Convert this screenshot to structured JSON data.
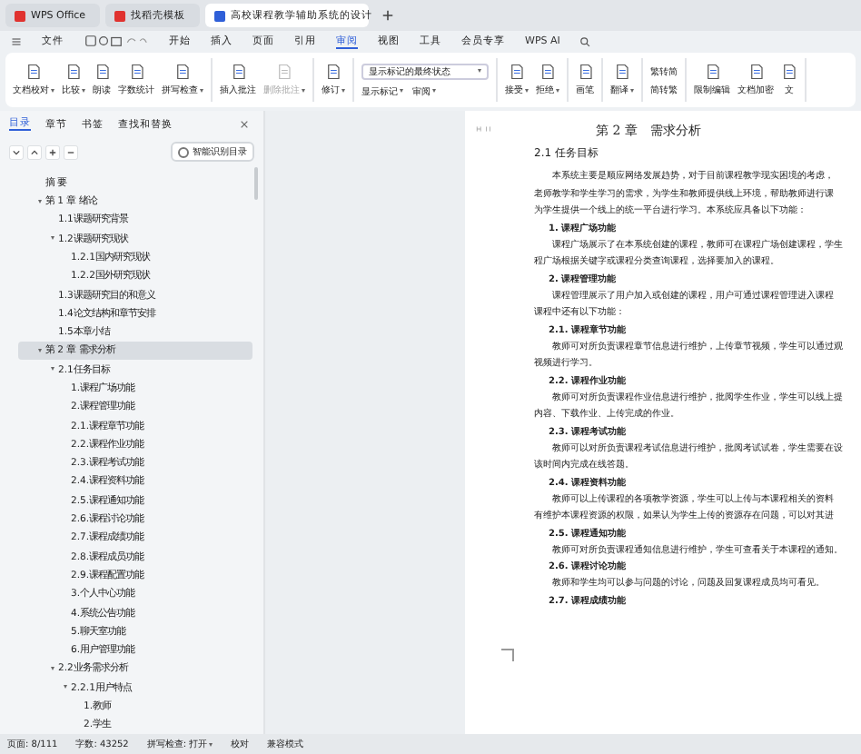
{
  "browser_tabs": [
    {
      "label": "WPS Office",
      "selected": false,
      "color": "#e0322f"
    },
    {
      "label": "找稻壳模板",
      "selected": false,
      "color": "#e0322f"
    },
    {
      "label": "高校课程教学辅助系统的设计",
      "selected": true,
      "color": "#2f5fd8"
    }
  ],
  "menu": {
    "file_label": "文件",
    "items": [
      {
        "label": "开始",
        "selected": false
      },
      {
        "label": "插入",
        "selected": false
      },
      {
        "label": "页面",
        "selected": false
      },
      {
        "label": "引用",
        "selected": false
      },
      {
        "label": "审阅",
        "selected": true
      },
      {
        "label": "视图",
        "selected": false
      },
      {
        "label": "工具",
        "selected": false
      },
      {
        "label": "会员专享",
        "selected": false
      }
    ],
    "ai_label": "WPS AI"
  },
  "ribbon": [
    [
      {
        "label": "文档校对",
        "dropdown": true
      },
      {
        "label": "比较",
        "dropdown": true
      },
      {
        "label": "朗读",
        "dropdown": false
      },
      {
        "label": "字数统计",
        "dropdown": false
      },
      {
        "label": "拼写检查",
        "dropdown": true
      }
    ],
    [
      {
        "label": "插入批注",
        "dropdown": false
      },
      {
        "label": "删除批注",
        "dropdown": true,
        "disabled": true
      }
    ],
    [
      {
        "label": "修订",
        "dropdown": true
      }
    ],
    [
      {
        "label": "接受",
        "dropdown": true
      },
      {
        "label": "拒绝",
        "dropdown": true
      }
    ],
    [
      {
        "label": "画笔",
        "dropdown": false
      }
    ],
    [
      {
        "label": "翻译",
        "dropdown": true
      }
    ],
    [
      {
        "label": "限制编辑",
        "dropdown": false
      },
      {
        "label": "文档加密",
        "dropdown": false
      },
      {
        "label": "文",
        "dropdown": false
      }
    ]
  ],
  "markup_select": {
    "value": "显示标记的最终状态",
    "show_markup": "显示标记",
    "review": "审阅"
  },
  "convert": {
    "to_simplified": "繁转简",
    "to_traditional": "简转繁"
  },
  "nav": {
    "tabs": [
      {
        "label": "目录",
        "selected": true
      },
      {
        "label": "章节",
        "selected": false
      },
      {
        "label": "书签",
        "selected": false
      },
      {
        "label": "查找和替换",
        "selected": false
      }
    ],
    "smart_toc": {
      "label": "智能识别目录",
      "checked": false
    },
    "tree": [
      {
        "label": "摘 要",
        "selected": false
      },
      {
        "label": "第 1 章 绪论",
        "selected": false,
        "expanded": true,
        "children": [
          {
            "label": "1.1课题研究背景",
            "selected": false
          },
          {
            "label": "1.2课题研究现状",
            "selected": false,
            "expanded": true,
            "children": [
              {
                "label": "1.2.1国内研究现状",
                "selected": false
              },
              {
                "label": "1.2.2国外研究现状",
                "selected": false
              }
            ]
          },
          {
            "label": "1.3课题研究目的和意义",
            "selected": false
          },
          {
            "label": "1.4论文结构和章节安排",
            "selected": false
          },
          {
            "label": "1.5本章小结",
            "selected": false
          }
        ]
      },
      {
        "label": "第 2 章 需求分析",
        "selected": true,
        "expanded": true,
        "children": [
          {
            "label": "2.1任务目标",
            "selected": false,
            "expanded": true,
            "children": [
              {
                "label": "1.课程广场功能",
                "selected": false
              },
              {
                "label": "2.课程管理功能",
                "selected": false
              },
              {
                "label": "2.1.课程章节功能",
                "selected": false
              },
              {
                "label": "2.2.课程作业功能",
                "selected": false
              },
              {
                "label": "2.3.课程考试功能",
                "selected": false
              },
              {
                "label": "2.4.课程资料功能",
                "selected": false
              },
              {
                "label": "2.5.课程通知功能",
                "selected": false
              },
              {
                "label": "2.6.课程讨论功能",
                "selected": false
              },
              {
                "label": "2.7.课程成绩功能",
                "selected": false
              },
              {
                "label": "2.8.课程成员功能",
                "selected": false
              },
              {
                "label": "2.9.课程配置功能",
                "selected": false
              },
              {
                "label": "3.个人中心功能",
                "selected": false
              },
              {
                "label": "4.系统公告功能",
                "selected": false
              },
              {
                "label": "5.聊天室功能",
                "selected": false
              },
              {
                "label": "6.用户管理功能",
                "selected": false
              }
            ]
          },
          {
            "label": "2.2业务需求分析",
            "selected": false,
            "expanded": true,
            "children": [
              {
                "label": "2.2.1用户特点",
                "selected": false,
                "expanded": true,
                "children": [
                  {
                    "label": "1.教师",
                    "selected": false
                  },
                  {
                    "label": "2.学生",
                    "selected": false
                  }
                ]
              }
            ]
          }
        ]
      }
    ]
  },
  "document": {
    "chapter": "第 2 章　需求分析",
    "section": "2.1 任务目标",
    "blocks": [
      {
        "kind": "para",
        "lines": [
          "本系统主要是顺应网络发展趋势，对于目前课程教学现实困境的考虑，",
          "老师教学和学生学习的需求，为学生和教师提供线上环境，帮助教师进行课",
          "为学生提供一个线上的统一平台进行学习。本系统应具备以下功能："
        ]
      },
      {
        "kind": "heading",
        "lines": [
          "1. 课程广场功能"
        ]
      },
      {
        "kind": "para",
        "lines": [
          "课程广场展示了在本系统创建的课程，教师可在课程广场创建课程，学生",
          "程广场根据关键字或课程分类查询课程，选择要加入的课程。"
        ]
      },
      {
        "kind": "heading",
        "lines": [
          "2. 课程管理功能"
        ]
      },
      {
        "kind": "para",
        "lines": [
          "课程管理展示了用户加入或创建的课程，用户可通过课程管理进入课程",
          "课程中还有以下功能："
        ]
      },
      {
        "kind": "heading",
        "lines": [
          "2.1. 课程章节功能"
        ]
      },
      {
        "kind": "para",
        "lines": [
          "教师可对所负责课程章节信息进行维护，上传章节视频，学生可以通过观",
          "视频进行学习。"
        ]
      },
      {
        "kind": "heading",
        "lines": [
          "2.2. 课程作业功能"
        ]
      },
      {
        "kind": "para",
        "lines": [
          "教师可对所负责课程作业信息进行维护，批阅学生作业，学生可以线上提",
          "内容、下载作业、上传完成的作业。"
        ]
      },
      {
        "kind": "heading",
        "lines": [
          "2.3. 课程考试功能"
        ]
      },
      {
        "kind": "para",
        "lines": [
          "教师可以对所负责课程考试信息进行维护，批阅考试试卷，学生需要在设",
          "该时间内完成在线答题。"
        ]
      },
      {
        "kind": "heading",
        "lines": [
          "2.4. 课程资料功能"
        ]
      },
      {
        "kind": "para",
        "lines": [
          "教师可以上传课程的各项教学资源，学生可以上传与本课程相关的资料",
          "有维护本课程资源的权限，如果认为学生上传的资源存在问题，可以对其进"
        ]
      },
      {
        "kind": "heading",
        "lines": [
          "2.5. 课程通知功能"
        ]
      },
      {
        "kind": "para",
        "lines": [
          "教师可对所负责课程通知信息进行维护，学生可查看关于本课程的通知。"
        ]
      },
      {
        "kind": "heading",
        "lines": [
          "2.6. 课程讨论功能"
        ]
      },
      {
        "kind": "para",
        "lines": [
          "教师和学生均可以参与问题的讨论，问题及回复课程成员均可看见。"
        ]
      },
      {
        "kind": "heading",
        "lines": [
          "2.7. 课程成绩功能"
        ]
      }
    ]
  },
  "status_bar": [
    {
      "label": "页面: 8/111",
      "dropdown": false
    },
    {
      "label": "字数: 43252",
      "dropdown": false
    },
    {
      "label": "拼写检查: 打开",
      "dropdown": true
    },
    {
      "label": "校对",
      "dropdown": false
    },
    {
      "label": "兼容模式",
      "dropdown": false
    }
  ]
}
